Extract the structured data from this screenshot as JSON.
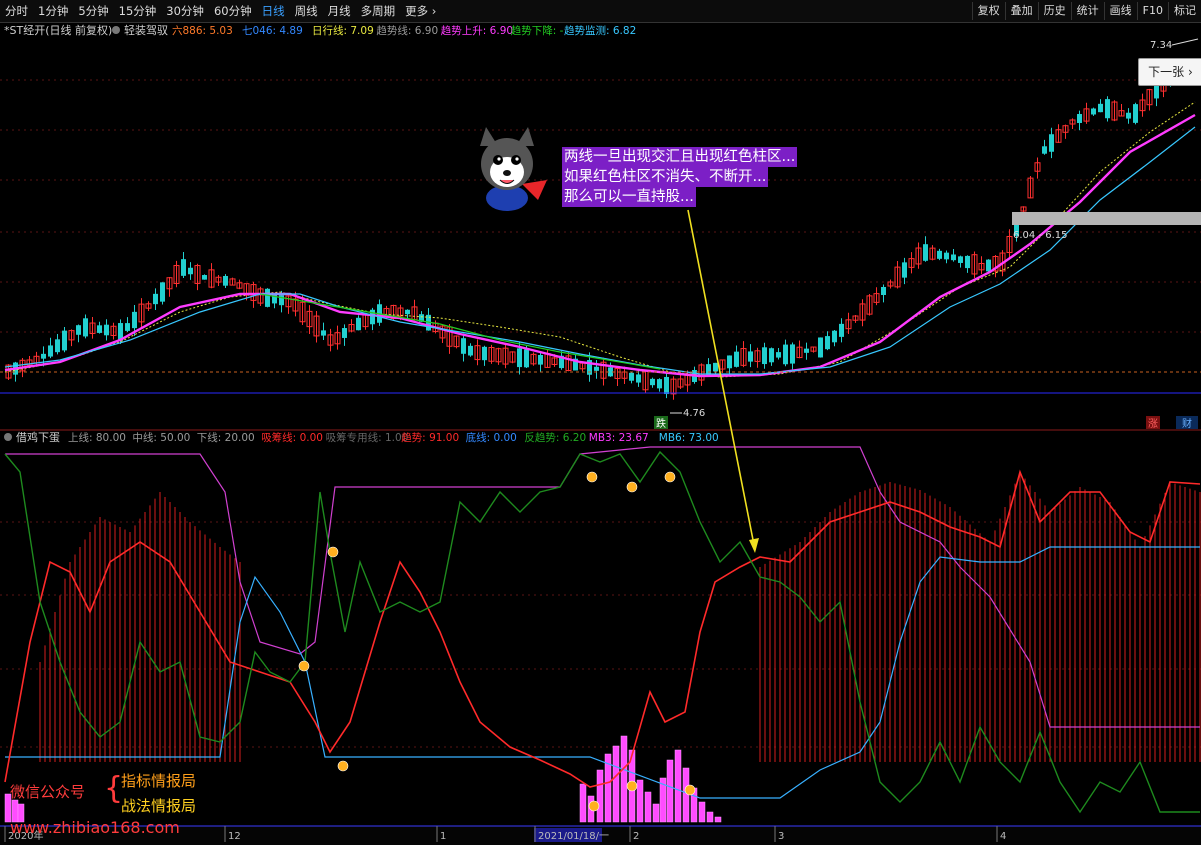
{
  "toolbar": {
    "timeframes": [
      "分时",
      "1分钟",
      "5分钟",
      "15分钟",
      "30分钟",
      "60分钟",
      "日线",
      "周线",
      "月线",
      "多周期",
      "更多"
    ],
    "active": "日线",
    "right_tools": [
      "复权",
      "叠加",
      "历史",
      "统计",
      "画线",
      "F10",
      "标记"
    ]
  },
  "price_panel": {
    "title": "*ST经开(日线 前复权)",
    "indicator_name": "轻装驾驭",
    "legend": [
      {
        "text": "六886: 5.03",
        "color": "#ff7a2a"
      },
      {
        "text": "七046: 4.89",
        "color": "#3388ff"
      },
      {
        "text": "日行线: 7.09",
        "color": "#e8e840"
      },
      {
        "text": "趋势线: 6.90",
        "color": "#9a9a9a"
      },
      {
        "text": "趋势上升: 6.90",
        "color": "#ff3cff"
      },
      {
        "text": "趋势下降: -",
        "color": "#22cc22"
      },
      {
        "text": "趋势监测: 6.82",
        "color": "#38c8ff"
      }
    ],
    "high_label": "7.34",
    "low_label": "4.76",
    "range_label": "6.04 - 6.15",
    "die_badge": "跌",
    "zhang_badge": "涨",
    "cai_badge": "财"
  },
  "next_button": "下一张",
  "callout": {
    "line1": "两线一旦出现交汇且出现红色柱区...",
    "line2": "如果红色柱区不消失、不断开...",
    "line3": "那么可以一直持股..."
  },
  "lower_panel": {
    "name": "借鸡下蛋",
    "legend": [
      {
        "text": "上线: 80.00",
        "color": "#9a9a9a"
      },
      {
        "text": "中线: 50.00",
        "color": "#9a9a9a"
      },
      {
        "text": "下线: 20.00",
        "color": "#9a9a9a"
      },
      {
        "text": "吸筹线: 0.00",
        "color": "#ff2a2a"
      },
      {
        "text": "吸筹专用线: 1.00",
        "color": "#666666"
      },
      {
        "text": "趋势: 91.00",
        "color": "#ff2a2a"
      },
      {
        "text": "底线: 0.00",
        "color": "#3388ff"
      },
      {
        "text": "反趋势: 6.20",
        "color": "#22aa22"
      },
      {
        "text": "MB3: 23.67",
        "color": "#ff3cff"
      },
      {
        "text": "MB6: 73.00",
        "color": "#38c8ff"
      }
    ]
  },
  "watermark": {
    "wechat": "微信公众号",
    "tag1": "指标情报局",
    "tag2": "战法情报局",
    "site": "www.zhibiao168.com"
  },
  "time_axis": {
    "labels": [
      "2020年",
      "12",
      "1",
      "2021/01/18/一",
      "2",
      "3",
      "4"
    ]
  }
}
